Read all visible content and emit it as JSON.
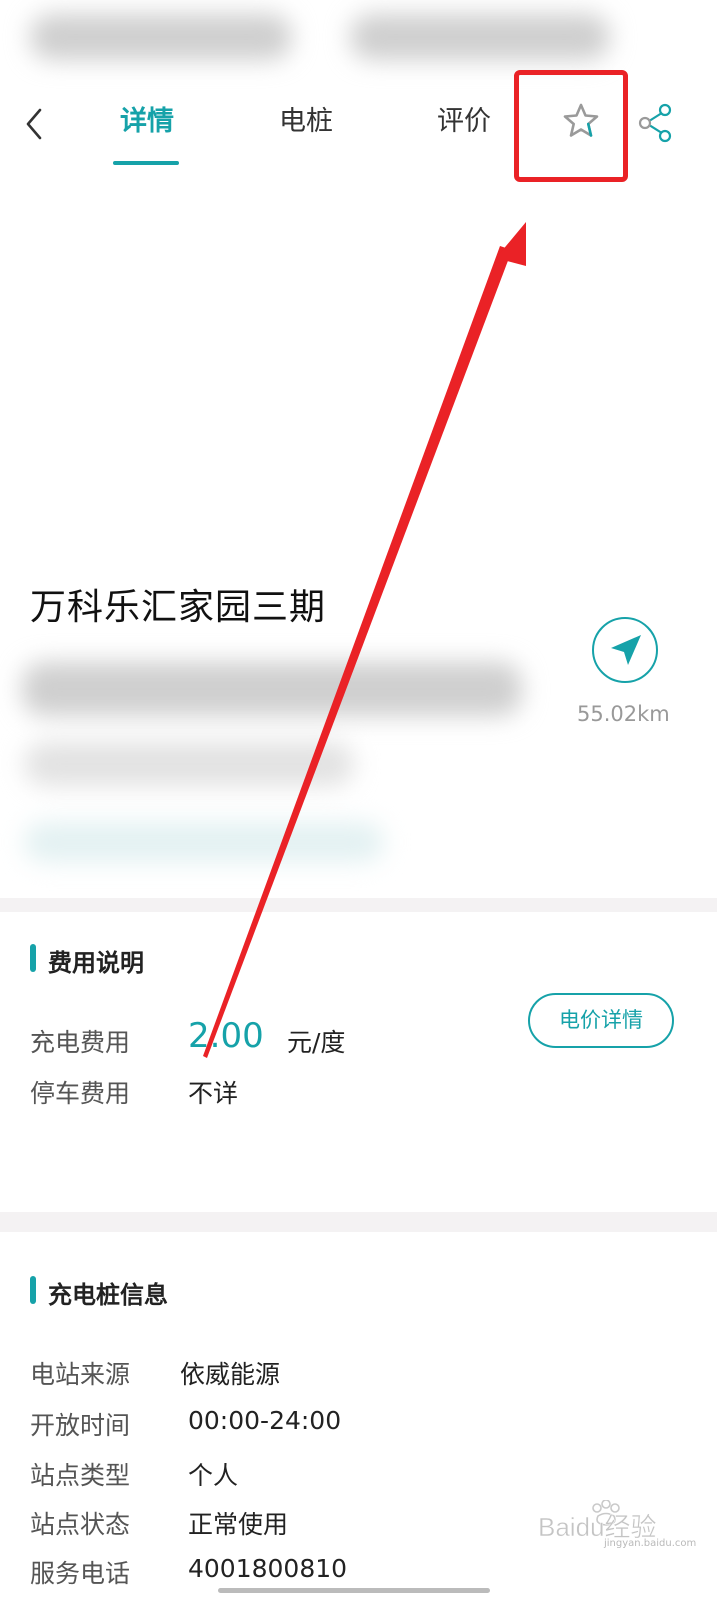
{
  "tabs": {
    "details": "详情",
    "piles": "电桩",
    "reviews": "评价"
  },
  "station": {
    "name": "万科乐汇家园三期",
    "distance": "55.02km"
  },
  "fees": {
    "title": "费用说明",
    "charging_label": "充电费用",
    "charging_price": "2.00",
    "charging_unit": "元/度",
    "parking_label": "停车费用",
    "parking_value": "不详",
    "detail_button": "电价详情"
  },
  "pile_info": {
    "title": "充电桩信息",
    "rows": [
      {
        "label": "电站来源",
        "value": "依威能源"
      },
      {
        "label": "开放时间",
        "value": "00:00-24:00"
      },
      {
        "label": "站点类型",
        "value": "个人"
      },
      {
        "label": "站点状态",
        "value": "正常使用"
      },
      {
        "label": "服务电话",
        "value": "4001800810"
      }
    ]
  },
  "watermark": {
    "brand": "Baidu经验",
    "site": "jingyan.baidu.com"
  },
  "colors": {
    "accent": "#16a2a9",
    "annotation": "#ea2226"
  }
}
